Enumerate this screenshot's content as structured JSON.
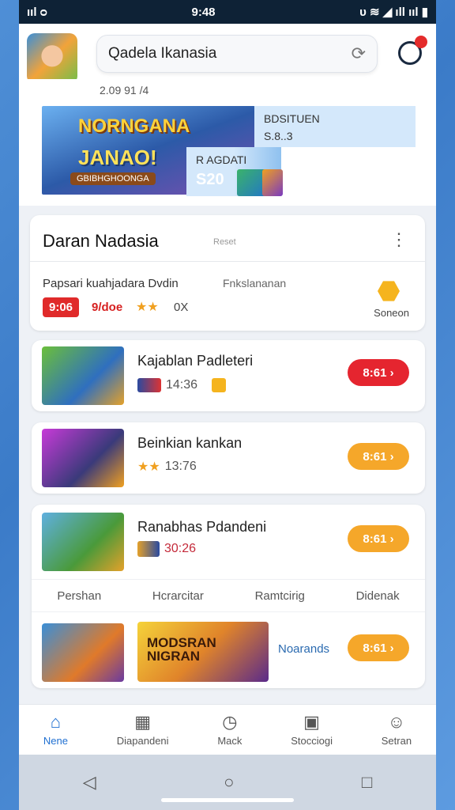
{
  "status_bar": {
    "left": "ııl ᴑ",
    "time": "9:48",
    "right": "ᴜ ≋ ◢ ıll ııl ▮"
  },
  "header": {
    "search_text": "Qadela Ikanasia",
    "refresh_icon": "⟳"
  },
  "banner": {
    "date": "2.09 91 /4",
    "title_top": "NORNGANA",
    "title_main": "JANAO!",
    "title_sub": "GBIBHGHOONGA",
    "info1_line1": "BDSITUEN",
    "info1_line2": "S.8..3",
    "info2_line1": "R AGDATI",
    "info2_price": "S20"
  },
  "section": {
    "title": "Daran Nadasia",
    "small_note": "Reset",
    "more_icon": "⋮",
    "sub_left": "Papsari kuahjadara Dvdin",
    "sub_right": "Fnkslananan",
    "badge_price": "9:06",
    "badge_red": "9/doe",
    "stars": "★★",
    "rating": "0X",
    "hex_label": "Soneon"
  },
  "games": [
    {
      "name": "Kajablan Padleteri",
      "meta": "14:36",
      "button": "8:61 ›",
      "color": "red"
    },
    {
      "name": "Beinkian kankan",
      "meta": "13:76",
      "button": "8:61 ›",
      "color": "orange"
    },
    {
      "name": "Ranabhas Pdandeni",
      "meta": "30:26",
      "button": "8:61 ›",
      "color": "orange"
    }
  ],
  "tabs_row": [
    "Pershan",
    "Hcrarcitar",
    "Ramtcirig",
    "Didenak"
  ],
  "last_card": {
    "img_title": "MODSRAN NIGRAN",
    "label": "Noarands",
    "button": "8:61 ›"
  },
  "bottom_nav": [
    {
      "label": "Nene",
      "icon": "⌂"
    },
    {
      "label": "Diapandeni",
      "icon": "▦"
    },
    {
      "label": "Mack",
      "icon": "◷"
    },
    {
      "label": "Stocciogi",
      "icon": "▣"
    },
    {
      "label": "Setran",
      "icon": "☺"
    }
  ],
  "system_nav": {
    "back": "◁",
    "home": "○",
    "recents": "□"
  }
}
